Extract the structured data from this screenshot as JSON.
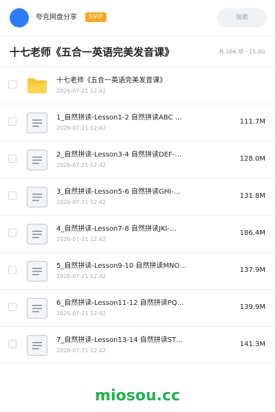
{
  "header": {
    "username": "夸克网盘分享",
    "badge": "SVIP",
    "search_placeholder": "搜索",
    "accent_color": "#2e7cf6",
    "badge_color": "#f5a623"
  },
  "folder": {
    "title": "十七老师《五合一英语完美发音课》",
    "meta": "共 166 项 · 15.0G"
  },
  "items": [
    {
      "type": "folder",
      "icon": "folder-icon",
      "name": "十七老师《五合一英语完美发音课》",
      "date": "2026-07-21 12:42",
      "size": ""
    },
    {
      "type": "file",
      "icon": "document-icon",
      "name": "1_自然拼读-Lesson1-2 自然拼读ABC …",
      "date": "2026-07-21 12:42",
      "size": "111.7M"
    },
    {
      "type": "file",
      "icon": "document-icon",
      "name": "2_自然拼读-Lesson3-4 自然拼读DEF-…",
      "date": "2026-07-21 12:42",
      "size": "128.0M"
    },
    {
      "type": "file",
      "icon": "document-icon",
      "name": "3_自然拼读-Lesson5-6 自然拼读GHI-…",
      "date": "2026-07-21 12:42",
      "size": "131.8M"
    },
    {
      "type": "file",
      "icon": "document-icon",
      "name": "4_自然拼读-Lesson7-8 自然拼读JKl-…",
      "date": "2026-07-21 12:42",
      "size": "186.4M"
    },
    {
      "type": "file",
      "icon": "document-icon",
      "name": "5_自然拼读-Lesson9-10 自然拼读MNO…",
      "date": "2026-07-21 12:42",
      "size": "137.9M"
    },
    {
      "type": "file",
      "icon": "document-icon",
      "name": "6_自然拼读-Lesson11-12 自然拼读PQ…",
      "date": "2026-07-21 12:42",
      "size": "139.9M"
    },
    {
      "type": "file",
      "icon": "document-icon",
      "name": "7_自然拼读-Lesson13-14 自然拼读ST…",
      "date": "2026-07-21 12:42",
      "size": "141.3M"
    }
  ],
  "watermark": "miosou.cc",
  "watermark_color": "#22b14c"
}
